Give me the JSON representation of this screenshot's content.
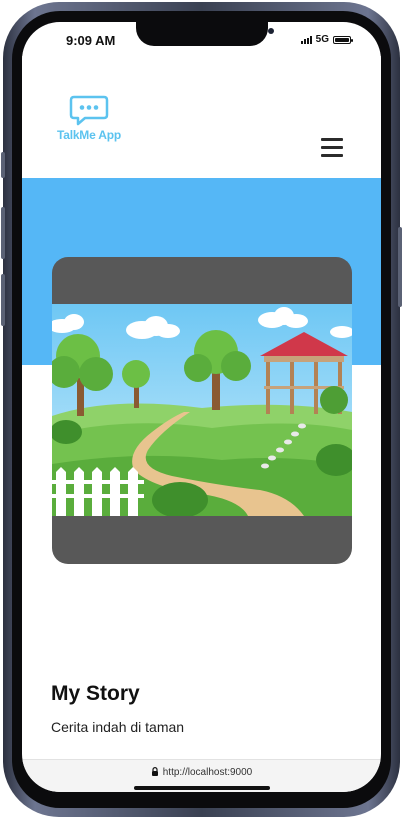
{
  "status_bar": {
    "time": "9:09 AM",
    "network": "5G",
    "icons": [
      "signal-icon",
      "battery-icon"
    ]
  },
  "app": {
    "name": "TalkMe App",
    "logo_icon": "chat-bubble-icon",
    "menu_icon": "hamburger-menu-icon"
  },
  "story": {
    "title": "My Story",
    "description": "Cerita indah di taman",
    "image_alt": "garden-illustration"
  },
  "browser": {
    "url": "http://localhost:9000",
    "lock_icon": "lock-icon"
  },
  "colors": {
    "brand": "#5cc3ef",
    "hero_band": "#55b7f6",
    "image_frame": "#585858"
  }
}
